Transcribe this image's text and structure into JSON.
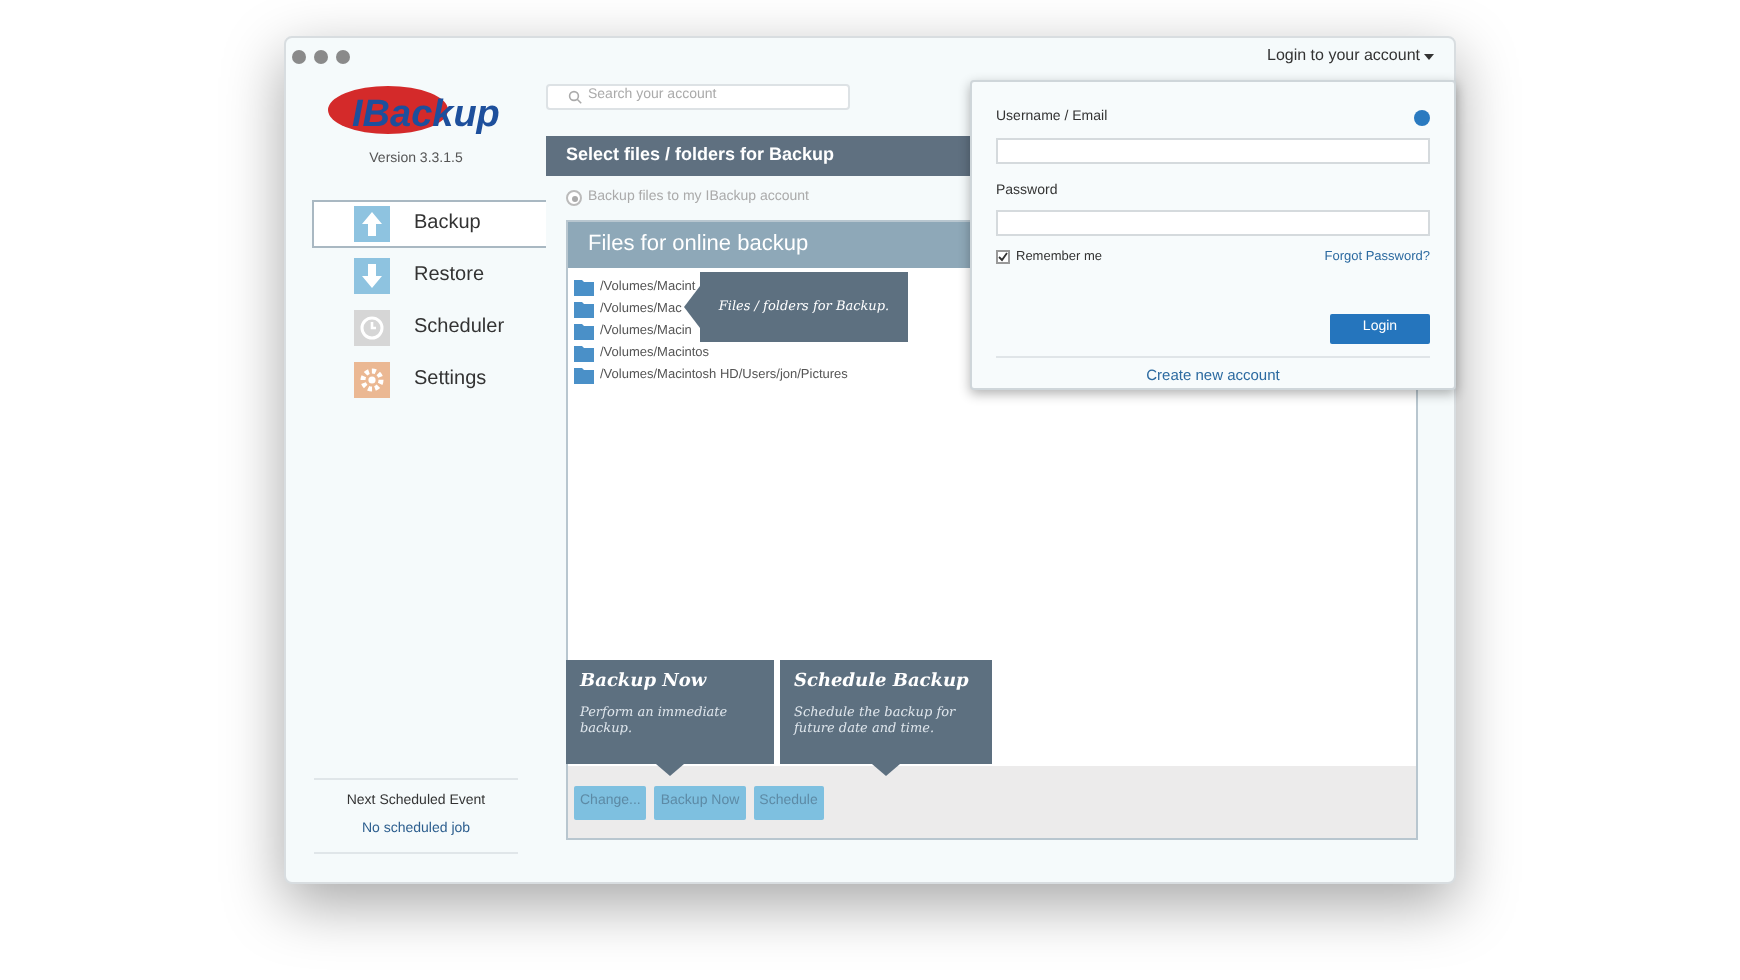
{
  "window": {
    "account_menu": "Login to your account"
  },
  "logo": {
    "text": "IBackup",
    "version": "Version 3.3.1.5"
  },
  "search": {
    "placeholder": "Search your account"
  },
  "sidebar": {
    "items": [
      {
        "label": "Backup",
        "kind": "backup",
        "selected": true
      },
      {
        "label": "Restore",
        "kind": "restore",
        "selected": false
      },
      {
        "label": "Scheduler",
        "kind": "scheduler",
        "selected": false
      },
      {
        "label": "Settings",
        "kind": "settings",
        "selected": false
      }
    ],
    "footer_title": "Next Scheduled Event",
    "footer_value": "No scheduled job"
  },
  "section_title": "Select files / folders for Backup",
  "radio": {
    "label": "Backup files to my IBackup account",
    "selected": true
  },
  "panel": {
    "title": "Files for online backup",
    "files": [
      {
        "path": "/Volumes/Macint"
      },
      {
        "path": "/Volumes/Mac"
      },
      {
        "path": "/Volumes/Macin"
      },
      {
        "path": "/Volumes/Macintos"
      },
      {
        "path": "/Volumes/Macintosh HD/Users/jon/Pictures"
      }
    ],
    "buttons": [
      "Change...",
      "Backup Now",
      "Schedule"
    ]
  },
  "tooltips": [
    {
      "kind": "side",
      "text": "Files / folders for Backup."
    },
    {
      "kind": "below",
      "title": "Backup Now",
      "text": "Perform an immediate backup."
    },
    {
      "kind": "below",
      "title": "Schedule Backup",
      "text": "Schedule the backup for future date and time."
    }
  ],
  "login": {
    "username_label": "Username / Email",
    "password_label": "Password",
    "remember": {
      "label": "Remember me",
      "checked": true
    },
    "forgot": "Forgot Password?",
    "button": "Login",
    "create": "Create new account"
  }
}
